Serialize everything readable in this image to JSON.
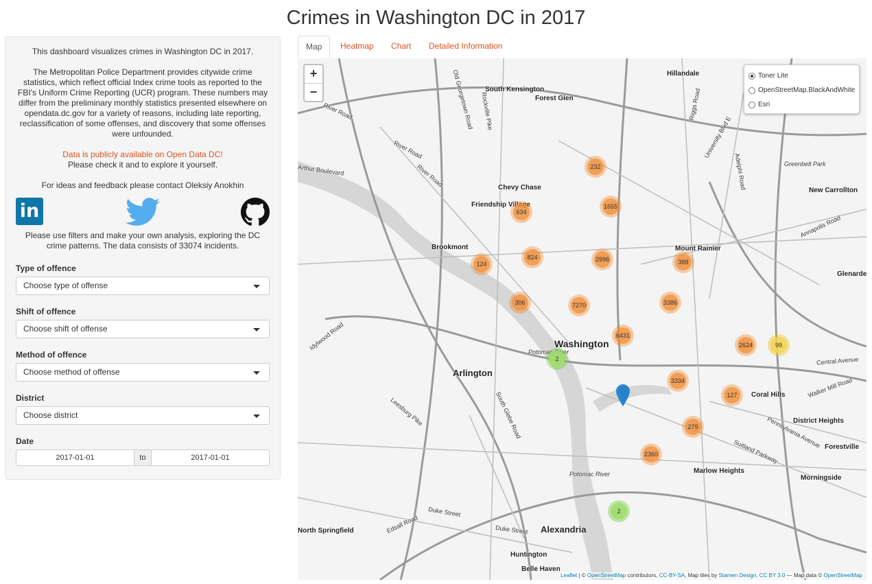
{
  "title": "Crimes in Washington DC in 2017",
  "sidebar": {
    "intro": "This dashboard visualizes crimes in Washington DC in 2017.",
    "description": "The Metropolitan Police Department provides citywide crime statistics, which reflect official Index crime tools as reported to the FBI's Uniform Crime Reporting (UCR) program. These numbers may differ from the preliminary monthly statistics presented elsewhere on opendata.dc.gov for a variety of reasons, including late reporting, reclassification of some offenses, and discovery that some offenses were unfounded.",
    "data_link": "Data is publicly available on Open Data DC!",
    "data_note": "Please check it and to explore it yourself.",
    "contact": "For ideas and feedback please contact Oleksiy Anokhin",
    "linkedin_text": "in",
    "usage": "Please use filters and make your own analysis, exploring the DC crime patterns. The data consists of 33074 incidents.",
    "filters": [
      {
        "label": "Type of offence",
        "placeholder": "Choose type of offense"
      },
      {
        "label": "Shift of offence",
        "placeholder": "Choose shift of offense"
      },
      {
        "label": "Method of offence",
        "placeholder": "Choose method of offense"
      },
      {
        "label": "District",
        "placeholder": "Choose district"
      }
    ],
    "date": {
      "label": "Date",
      "start": "2017-01-01",
      "separator": "to",
      "end": "2017-01-01"
    }
  },
  "tabs": [
    "Map",
    "Heatmap",
    "Chart",
    "Detailed Information"
  ],
  "active_tab": "Map",
  "map": {
    "zoom_in": "+",
    "zoom_out": "−",
    "layers": [
      "Toner Lite",
      "OpenStreetMap.BlackAndWhite",
      "Esri"
    ],
    "selected_layer": "Toner Lite",
    "clusters": [
      {
        "count": "232",
        "color": "orange"
      },
      {
        "count": "1655",
        "color": "orange"
      },
      {
        "count": "634",
        "color": "orange"
      },
      {
        "count": "124",
        "color": "orange"
      },
      {
        "count": "824",
        "color": "orange"
      },
      {
        "count": "2996",
        "color": "orange"
      },
      {
        "count": "388",
        "color": "orange"
      },
      {
        "count": "306",
        "color": "orange"
      },
      {
        "count": "7270",
        "color": "orange"
      },
      {
        "count": "3386",
        "color": "orange"
      },
      {
        "count": "6431",
        "color": "orange"
      },
      {
        "count": "2624",
        "color": "orange"
      },
      {
        "count": "99",
        "color": "yellow"
      },
      {
        "count": "2",
        "color": "green"
      },
      {
        "count": "3334",
        "color": "orange"
      },
      {
        "count": "127",
        "color": "orange"
      },
      {
        "count": "279",
        "color": "orange"
      },
      {
        "count": "2360",
        "color": "orange"
      },
      {
        "count": "2",
        "color": "green"
      }
    ],
    "places": [
      "Hillandale",
      "South Kensington",
      "Forest Glen",
      "Chevy Chase",
      "Friendship Village",
      "Brookmont",
      "Mount Rainier",
      "Washington",
      "Arlington",
      "Alexandria",
      "New Carrollton",
      "Glenarden",
      "Coral Hills",
      "District Heights",
      "Forestville",
      "Marlow Heights",
      "Morningside",
      "Huntington",
      "Belle Haven",
      "North Springfield",
      "Greenbelt Park"
    ],
    "roads": [
      "River Road",
      "Old Georgetown Road",
      "Rockville Pike",
      "Arthur Boulevard",
      "Riggs Road",
      "University Blvd E",
      "Adelphi Road",
      "Annapolis Road",
      "Idylwood Road",
      "Potomac River",
      "South Glebe Road",
      "Leesburg Pike",
      "Central Avenue",
      "Walker Mill Road",
      "Pennsylvania Avenue",
      "Suitland Parkway",
      "Duke Street",
      "Edsall Road"
    ],
    "attribution": {
      "leaflet": "Leaflet",
      "osm": "OpenStreetMap",
      "contributors": " contributors, ",
      "ccbysa": "CC-BY-SA",
      "tiles": ", Map tiles by ",
      "stamen": "Stamen Design, CC BY 3.0",
      "mapdata": " — Map data © ",
      "osm2": "OpenStreetMap"
    }
  }
}
